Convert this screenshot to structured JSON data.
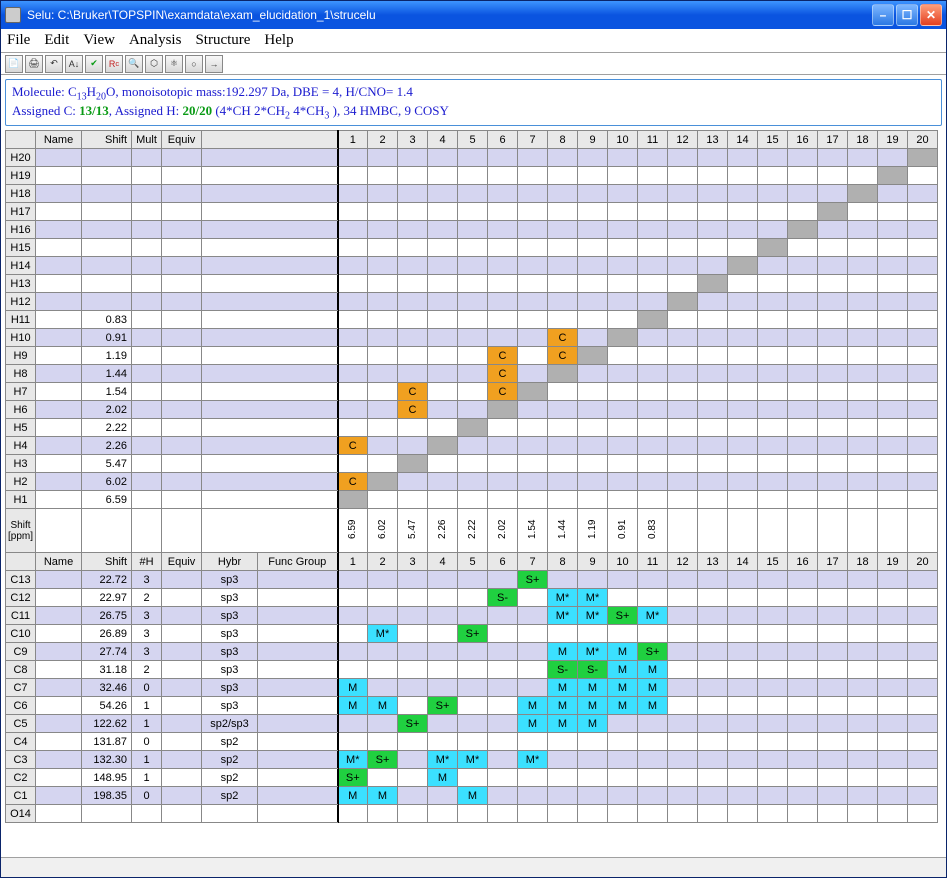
{
  "title": "Selu: C:\\Bruker\\TOPSPIN\\examdata\\exam_elucidation_1\\strucelu",
  "menu": {
    "file": "File",
    "edit": "Edit",
    "view": "View",
    "analysis": "Analysis",
    "structure": "Structure",
    "help": "Help"
  },
  "info": {
    "line1_pre": "Molecule: C",
    "c": "13",
    "line1_mid": "H",
    "h": "20",
    "line1_post": "O, monoisotopic mass:192.297 Da, DBE = 4, H/CNO= 1.4",
    "line2_pre": "Assigned C: ",
    "ac": "13/13",
    "line2_mid": ", Assigned H: ",
    "ah": "20/20",
    "line2_post": " (4*CH 2*CH",
    "sub2": "2",
    "line2_post2": " 4*CH",
    "sub3": "3",
    "line2_post3": " ), 34 HMBC, 9 COSY"
  },
  "headers": {
    "name": "Name",
    "shift": "Shift",
    "mult": "Mult",
    "equiv": "Equiv",
    "nH": "#H",
    "hybr": "Hybr",
    "func": "Func Group",
    "shift_ppm": "Shift [ppm]"
  },
  "hrows": [
    {
      "id": "H20",
      "shift": "",
      "cells": {
        "20": "g"
      }
    },
    {
      "id": "H19",
      "shift": "",
      "cells": {
        "19": "g"
      }
    },
    {
      "id": "H18",
      "shift": "",
      "cells": {
        "18": "g"
      }
    },
    {
      "id": "H17",
      "shift": "",
      "cells": {
        "17": "g"
      }
    },
    {
      "id": "H16",
      "shift": "",
      "cells": {
        "16": "g"
      }
    },
    {
      "id": "H15",
      "shift": "",
      "cells": {
        "15": "g"
      }
    },
    {
      "id": "H14",
      "shift": "",
      "cells": {
        "14": "g"
      }
    },
    {
      "id": "H13",
      "shift": "",
      "cells": {
        "13": "g"
      }
    },
    {
      "id": "H12",
      "shift": "",
      "cells": {
        "12": "g"
      }
    },
    {
      "id": "H11",
      "shift": "0.83",
      "cells": {
        "11": "g"
      }
    },
    {
      "id": "H10",
      "shift": "0.91",
      "cells": {
        "8": "C",
        "10": "g"
      }
    },
    {
      "id": "H9",
      "shift": "1.19",
      "cells": {
        "6": "C",
        "8": "C",
        "9": "g"
      }
    },
    {
      "id": "H8",
      "shift": "1.44",
      "cells": {
        "6": "C",
        "8": "g"
      }
    },
    {
      "id": "H7",
      "shift": "1.54",
      "cells": {
        "3": "C",
        "6": "C",
        "7": "g"
      }
    },
    {
      "id": "H6",
      "shift": "2.02",
      "cells": {
        "3": "C",
        "6": "g"
      }
    },
    {
      "id": "H5",
      "shift": "2.22",
      "cells": {
        "5": "g"
      }
    },
    {
      "id": "H4",
      "shift": "2.26",
      "cells": {
        "1": "C",
        "4": "g"
      }
    },
    {
      "id": "H3",
      "shift": "5.47",
      "cells": {
        "3": "g"
      }
    },
    {
      "id": "H2",
      "shift": "6.02",
      "cells": {
        "1": "C",
        "2": "g"
      }
    },
    {
      "id": "H1",
      "shift": "6.59",
      "cells": {
        "1": "g"
      }
    }
  ],
  "hshifts": [
    "6.59",
    "6.02",
    "5.47",
    "2.26",
    "2.22",
    "2.02",
    "1.54",
    "1.44",
    "1.19",
    "0.91",
    "0.83",
    "",
    "",
    "",
    "",
    "",
    "",
    "",
    "",
    ""
  ],
  "crows": [
    {
      "id": "C13",
      "shift": "22.72",
      "nH": "3",
      "hybr": "sp3",
      "cells": {
        "7": {
          "t": "S+",
          "c": "cS"
        }
      }
    },
    {
      "id": "C12",
      "shift": "22.97",
      "nH": "2",
      "hybr": "sp3",
      "cells": {
        "6": {
          "t": "S-",
          "c": "cS"
        },
        "8": {
          "t": "M*",
          "c": "cM"
        },
        "9": {
          "t": "M*",
          "c": "cM"
        }
      }
    },
    {
      "id": "C11",
      "shift": "26.75",
      "nH": "3",
      "hybr": "sp3",
      "cells": {
        "8": {
          "t": "M*",
          "c": "cM"
        },
        "9": {
          "t": "M*",
          "c": "cM"
        },
        "10": {
          "t": "S+",
          "c": "cS"
        },
        "11": {
          "t": "M*",
          "c": "cM"
        }
      }
    },
    {
      "id": "C10",
      "shift": "26.89",
      "nH": "3",
      "hybr": "sp3",
      "cells": {
        "2": {
          "t": "M*",
          "c": "cM"
        },
        "5": {
          "t": "S+",
          "c": "cS"
        }
      }
    },
    {
      "id": "C9",
      "shift": "27.74",
      "nH": "3",
      "hybr": "sp3",
      "cells": {
        "8": {
          "t": "M",
          "c": "cM"
        },
        "9": {
          "t": "M*",
          "c": "cM"
        },
        "10": {
          "t": "M",
          "c": "cM"
        },
        "11": {
          "t": "S+",
          "c": "cS"
        }
      }
    },
    {
      "id": "C8",
      "shift": "31.18",
      "nH": "2",
      "hybr": "sp3",
      "cells": {
        "8": {
          "t": "S-",
          "c": "cS"
        },
        "9": {
          "t": "S-",
          "c": "cS"
        },
        "10": {
          "t": "M",
          "c": "cM"
        },
        "11": {
          "t": "M",
          "c": "cM"
        }
      }
    },
    {
      "id": "C7",
      "shift": "32.46",
      "nH": "0",
      "hybr": "sp3",
      "cells": {
        "1": {
          "t": "M",
          "c": "cM"
        },
        "8": {
          "t": "M",
          "c": "cM"
        },
        "9": {
          "t": "M",
          "c": "cM"
        },
        "10": {
          "t": "M",
          "c": "cM"
        },
        "11": {
          "t": "M",
          "c": "cM"
        }
      }
    },
    {
      "id": "C6",
      "shift": "54.26",
      "nH": "1",
      "hybr": "sp3",
      "cells": {
        "1": {
          "t": "M",
          "c": "cM"
        },
        "2": {
          "t": "M",
          "c": "cM"
        },
        "4": {
          "t": "S+",
          "c": "cS"
        },
        "7": {
          "t": "M",
          "c": "cM"
        },
        "8": {
          "t": "M",
          "c": "cM"
        },
        "9": {
          "t": "M",
          "c": "cM"
        },
        "10": {
          "t": "M",
          "c": "cM"
        },
        "11": {
          "t": "M",
          "c": "cM"
        }
      }
    },
    {
      "id": "C5",
      "shift": "122.62",
      "nH": "1",
      "hybr": "sp2/sp3",
      "cells": {
        "3": {
          "t": "S+",
          "c": "cS"
        },
        "7": {
          "t": "M",
          "c": "cM"
        },
        "8": {
          "t": "M",
          "c": "cM"
        },
        "9": {
          "t": "M",
          "c": "cM"
        }
      }
    },
    {
      "id": "C4",
      "shift": "131.87",
      "nH": "0",
      "hybr": "sp2",
      "cells": {}
    },
    {
      "id": "C3",
      "shift": "132.30",
      "nH": "1",
      "hybr": "sp2",
      "cells": {
        "1": {
          "t": "M*",
          "c": "cM"
        },
        "2": {
          "t": "S+",
          "c": "cS"
        },
        "4": {
          "t": "M*",
          "c": "cM"
        },
        "5": {
          "t": "M*",
          "c": "cM"
        },
        "7": {
          "t": "M*",
          "c": "cM"
        }
      }
    },
    {
      "id": "C2",
      "shift": "148.95",
      "nH": "1",
      "hybr": "sp2",
      "cells": {
        "1": {
          "t": "S+",
          "c": "cS"
        },
        "4": {
          "t": "M",
          "c": "cM"
        }
      }
    },
    {
      "id": "C1",
      "shift": "198.35",
      "nH": "0",
      "hybr": "sp2",
      "cells": {
        "1": {
          "t": "M",
          "c": "cM"
        },
        "2": {
          "t": "M",
          "c": "cM"
        },
        "5": {
          "t": "M",
          "c": "cM"
        }
      }
    },
    {
      "id": "O14",
      "shift": "",
      "nH": "",
      "hybr": "",
      "cells": {}
    }
  ]
}
